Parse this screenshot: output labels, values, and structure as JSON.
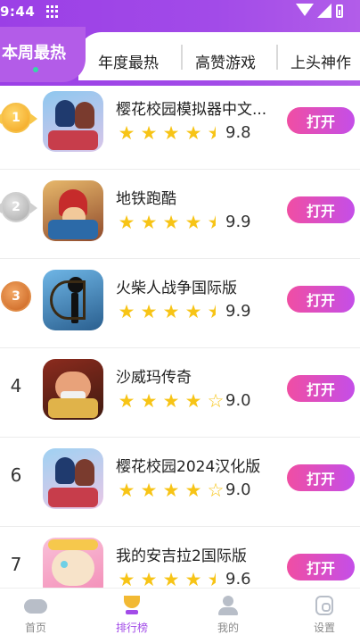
{
  "status": {
    "time": "9:44"
  },
  "tabs": [
    {
      "label": "本周最热",
      "active": true
    },
    {
      "label": "年度最热",
      "active": false
    },
    {
      "label": "高赞游戏",
      "active": false
    },
    {
      "label": "上头神作",
      "active": false
    }
  ],
  "games": [
    {
      "rank": "1",
      "medal": "gold",
      "title": "樱花校园模拟器中文...",
      "stars": [
        1,
        1,
        1,
        1,
        0.5
      ],
      "score": "9.8",
      "button": "打开"
    },
    {
      "rank": "2",
      "medal": "silver",
      "title": "地铁跑酷",
      "stars": [
        1,
        1,
        1,
        1,
        0.5
      ],
      "score": "9.9",
      "button": "打开"
    },
    {
      "rank": "3",
      "medal": "bronze",
      "title": "火柴人战争国际版",
      "stars": [
        1,
        1,
        1,
        1,
        0.5
      ],
      "score": "9.9",
      "button": "打开"
    },
    {
      "rank": "4",
      "medal": "",
      "title": "沙威玛传奇",
      "stars": [
        1,
        1,
        1,
        1,
        0
      ],
      "score": "9.0",
      "button": "打开"
    },
    {
      "rank": "6",
      "medal": "",
      "title": "樱花校园2024汉化版",
      "stars": [
        1,
        1,
        1,
        1,
        0
      ],
      "score": "9.0",
      "button": "打开"
    },
    {
      "rank": "7",
      "medal": "",
      "title": "我的安吉拉2国际版",
      "stars": [
        1,
        1,
        1,
        1,
        0.5
      ],
      "score": "9.6",
      "button": "打开"
    }
  ],
  "nav": [
    {
      "label": "首页",
      "icon": "gamepad-icon",
      "active": false
    },
    {
      "label": "排行榜",
      "icon": "trophy-icon",
      "active": true
    },
    {
      "label": "我的",
      "icon": "person-icon",
      "active": false
    },
    {
      "label": "设置",
      "icon": "settings-icon",
      "active": false
    }
  ]
}
